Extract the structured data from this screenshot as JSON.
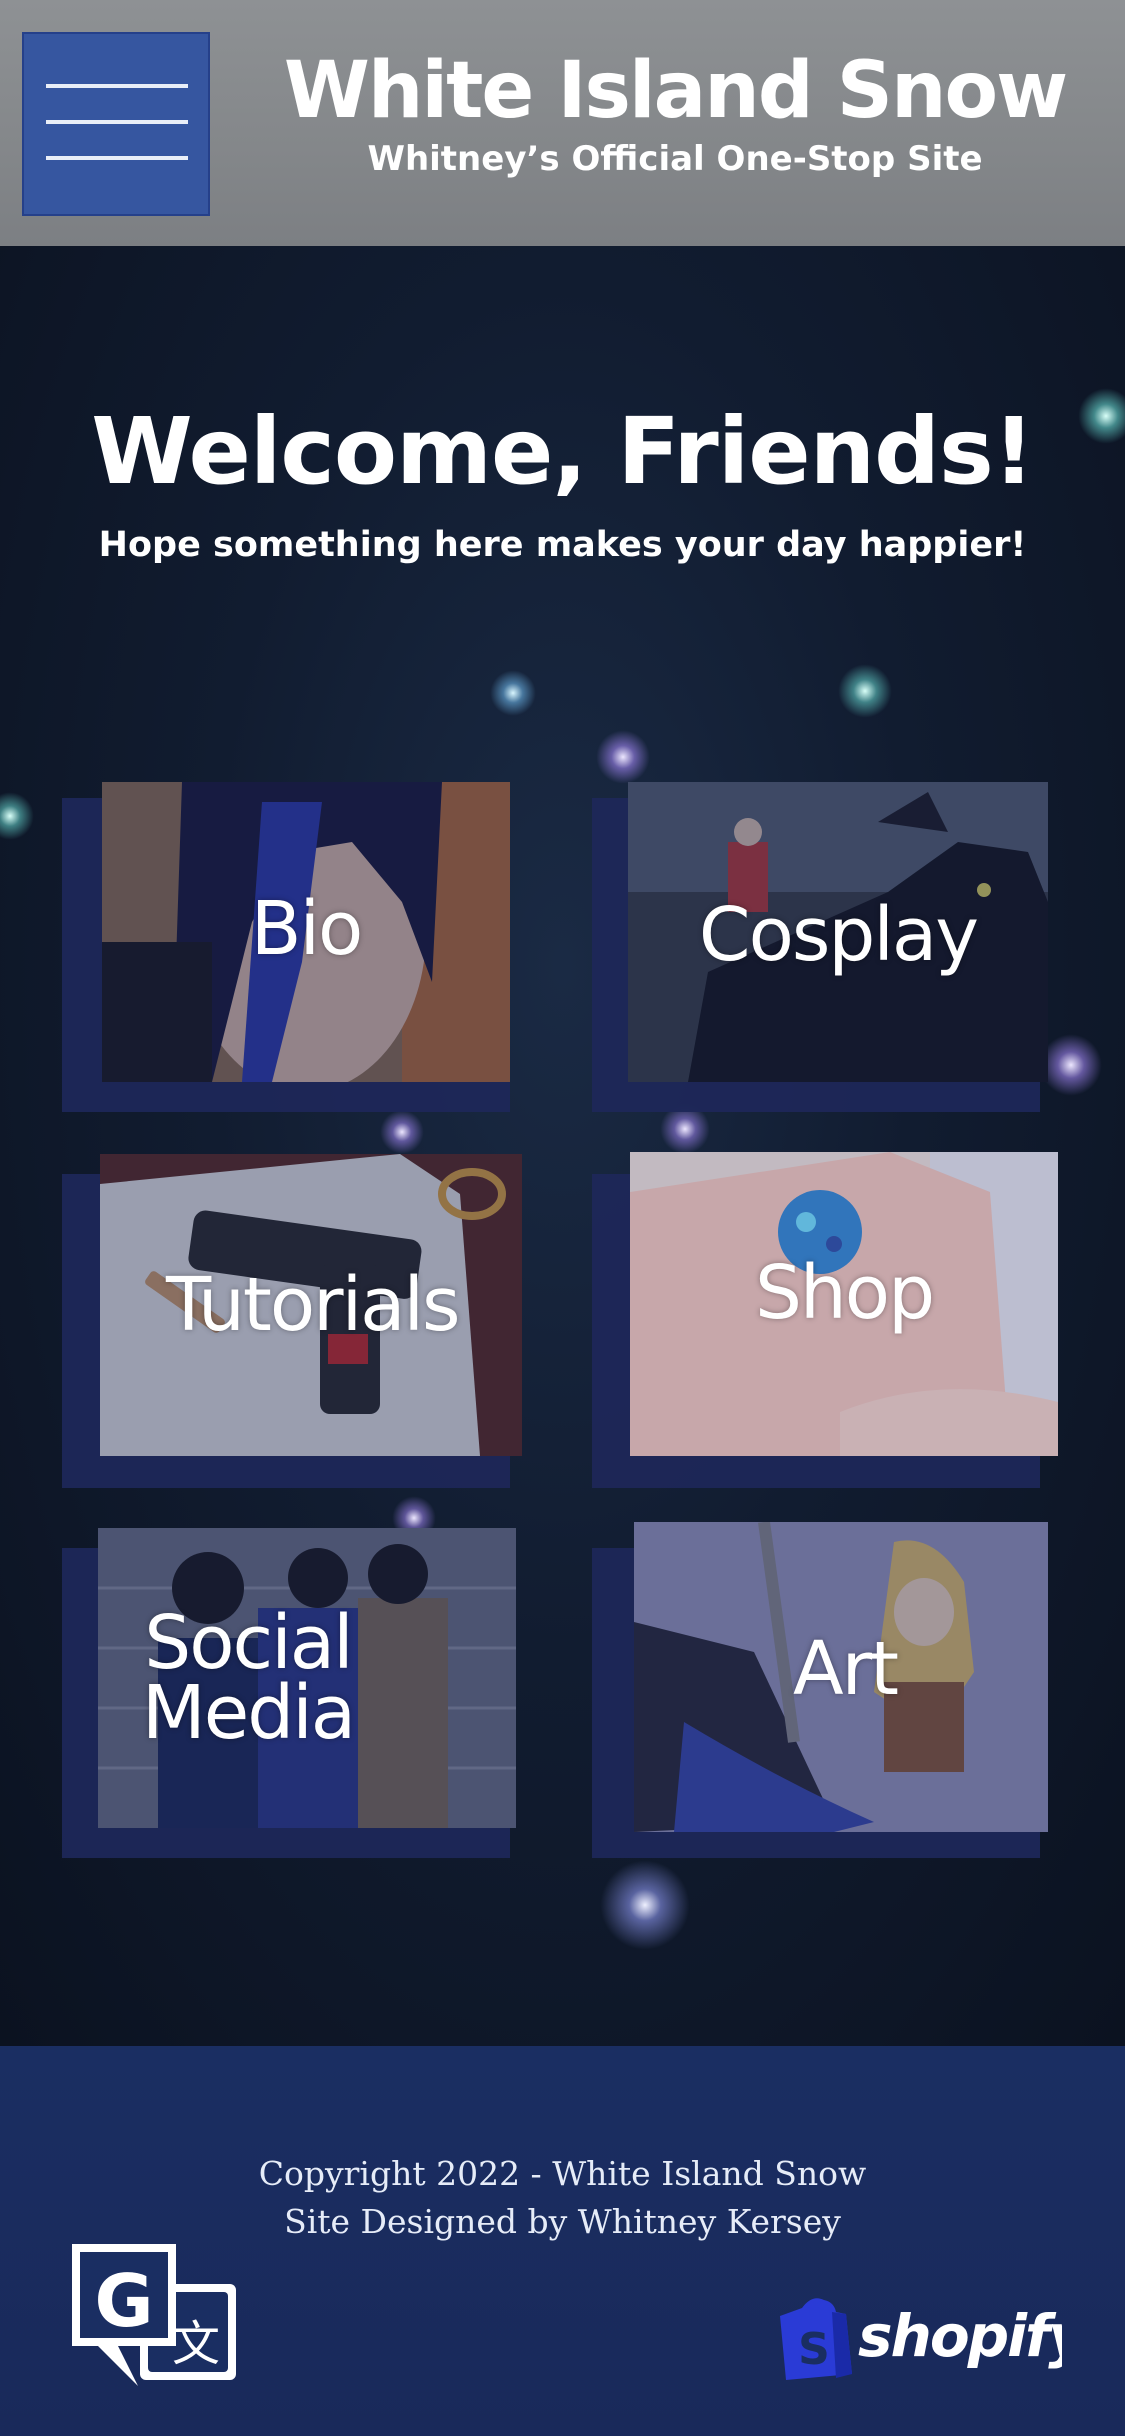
{
  "header": {
    "menu_icon": "hamburger-menu-icon",
    "title": "White Island Snow",
    "subtitle": "Whitney’s Official One-Stop Site"
  },
  "hero": {
    "heading": "Welcome, Friends!",
    "tagline": "Hope something here makes your day happier!"
  },
  "tiles": [
    {
      "label": "Bio"
    },
    {
      "label": "Cosplay"
    },
    {
      "label": "Tutorials"
    },
    {
      "label": "Shop"
    },
    {
      "label": "Social Media"
    },
    {
      "label": "Art"
    }
  ],
  "footer": {
    "copyright": "Copyright 2022 - White Island Snow",
    "designer": "Site Designed by Whitney Kersey",
    "translate_icon": "google-translate-icon",
    "shopify_logo": "shopify"
  },
  "colors": {
    "header_bg": "#8a8d90",
    "menu_button": "#3656a0",
    "page_bg": "#0d1524",
    "tile_shadow": "#1e2758",
    "footer_bg": "#1a2e62",
    "shopify_green": "#2a3bd6"
  }
}
